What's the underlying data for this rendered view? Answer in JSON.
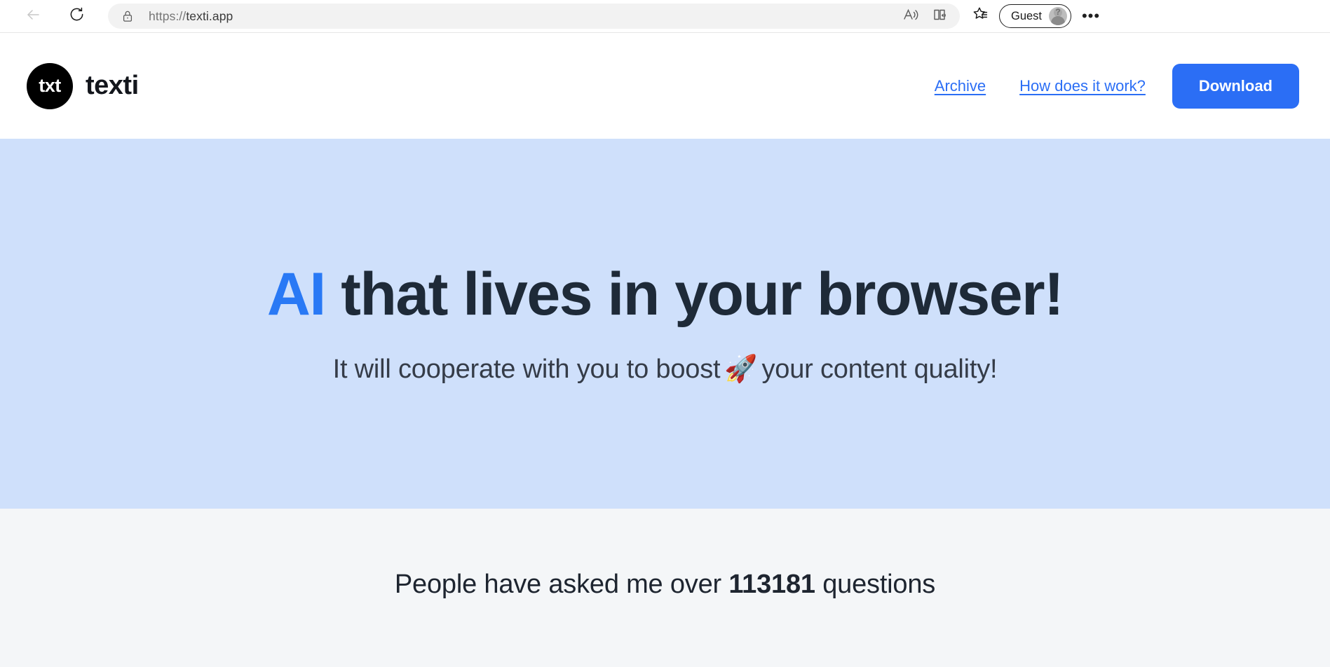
{
  "browser": {
    "back_icon": "back-arrow-icon",
    "reload_icon": "reload-icon",
    "lock_icon": "lock-icon",
    "url_scheme": "https://",
    "url_host": "texti.app",
    "url_full": "https://texti.app",
    "read_aloud_icon": "read-aloud-icon",
    "immersive_reader_icon": "immersive-reader-icon",
    "favorites_icon": "favorites-star-icon",
    "profile_label": "Guest",
    "avatar_icon": "guest-avatar-icon",
    "settings_icon": "more-options-icon",
    "settings_label": "•••"
  },
  "site_header": {
    "logo_mark_text": "txt",
    "brand_name": "texti",
    "nav_links": [
      {
        "label": "Archive"
      },
      {
        "label": "How does it work?"
      }
    ],
    "download_label": "Download"
  },
  "hero": {
    "title_accent": "AI",
    "title_rest": " that lives in your browser!",
    "subtitle_before": "It will cooperate with you to boost",
    "subtitle_emoji": "🚀",
    "subtitle_after": "your content quality!",
    "bg_color": "#cfe0fb",
    "accent_color": "#2979f5",
    "text_color": "#1e2a38"
  },
  "stats": {
    "prefix": "People have asked me over",
    "count": "113181",
    "suffix": "questions",
    "bg_color": "#f4f6f8"
  }
}
